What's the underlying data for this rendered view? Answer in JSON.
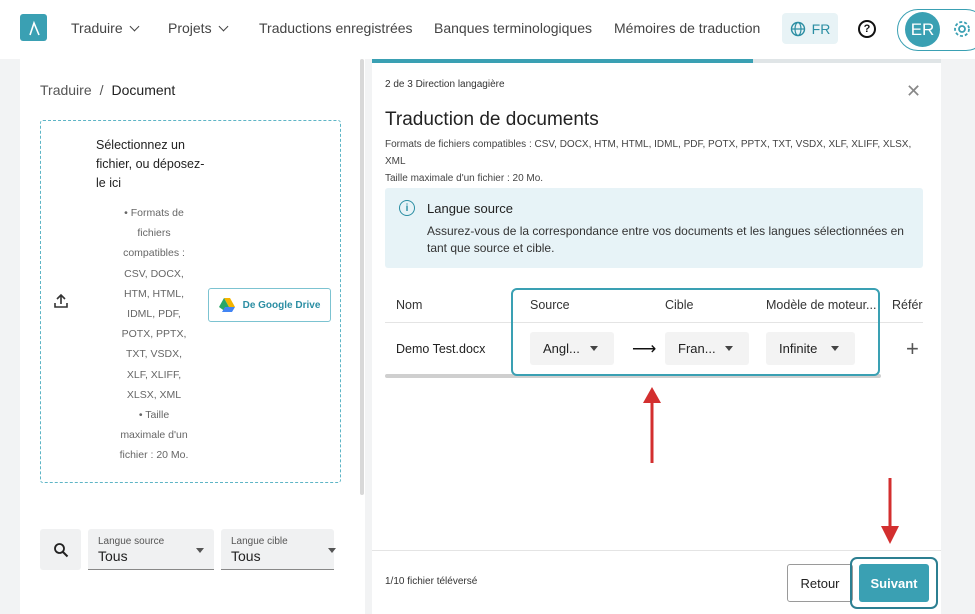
{
  "nav": {
    "items": [
      "Traduire",
      "Projets",
      "Traductions enregistrées",
      "Banques terminologiques",
      "Mémoires de traduction"
    ],
    "language": "FR",
    "avatar_initials": "ER",
    "help_glyph": "?"
  },
  "left": {
    "breadcrumb_root": "Traduire",
    "breadcrumb_sep": "/",
    "breadcrumb_current": "Document",
    "drop_title": "Sélectionnez un fichier, ou déposez-le ici",
    "formats_bullet": "Formats de fichiers compatibles : CSV, DOCX, HTM, HTML, IDML, PDF, POTX, PPTX, TXT, VSDX, XLF, XLIFF, XLSX, XML",
    "size_bullet": "Taille maximale d'un fichier : 20 Mo.",
    "gdrive_label": "De Google Drive",
    "filter_source_label": "Langue source",
    "filter_source_value": "Tous",
    "filter_target_label": "Langue cible",
    "filter_target_value": "Tous"
  },
  "dialog": {
    "step": "2 de 3 Direction langagière",
    "progress": 0.67,
    "title": "Traduction de documents",
    "formats": "Formats de fichiers compatibles : CSV, DOCX, HTM, HTML, IDML, PDF, POTX, PPTX, TXT, VSDX, XLF, XLIFF, XLSX, XML",
    "max_size": "Taille maximale d'un fichier : 20 Mo.",
    "info_title": "Langue source",
    "info_body": "Assurez-vous de la correspondance entre vos documents et les langues sélectionnées en tant que source et cible.",
    "columns": [
      "Nom",
      "Source",
      "Cible",
      "Modèle de moteur...",
      "Référ"
    ],
    "row": {
      "name": "Demo Test.docx",
      "source": "Angl...",
      "target": "Fran...",
      "engine": "Infinite"
    },
    "uploaded": "1/10 fichier téléversé",
    "back_label": "Retour",
    "next_label": "Suivant"
  },
  "colors": {
    "accent": "#3aa0b3",
    "annotation": "#d32f2f",
    "info_bg": "#e7f3f7"
  }
}
